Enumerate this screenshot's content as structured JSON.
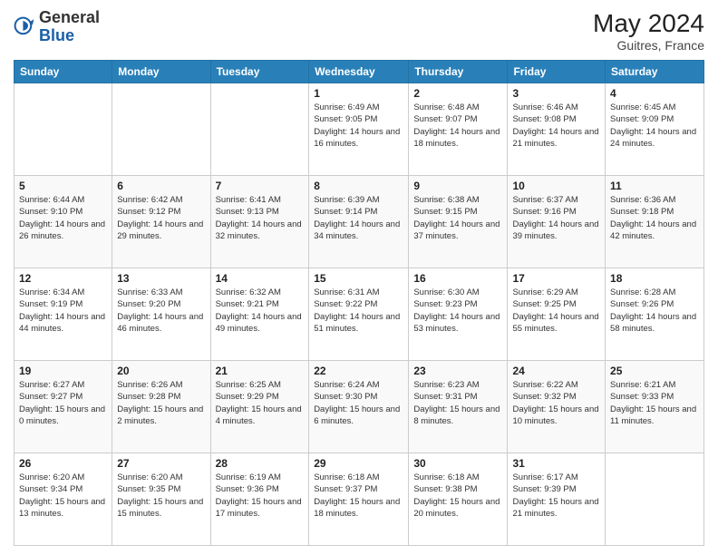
{
  "header": {
    "logo_general": "General",
    "logo_blue": "Blue",
    "month_year": "May 2024",
    "location": "Guitres, France"
  },
  "days_of_week": [
    "Sunday",
    "Monday",
    "Tuesday",
    "Wednesday",
    "Thursday",
    "Friday",
    "Saturday"
  ],
  "weeks": [
    [
      {
        "day": "",
        "sunrise": "",
        "sunset": "",
        "daylight": ""
      },
      {
        "day": "",
        "sunrise": "",
        "sunset": "",
        "daylight": ""
      },
      {
        "day": "",
        "sunrise": "",
        "sunset": "",
        "daylight": ""
      },
      {
        "day": "1",
        "sunrise": "Sunrise: 6:49 AM",
        "sunset": "Sunset: 9:05 PM",
        "daylight": "Daylight: 14 hours and 16 minutes."
      },
      {
        "day": "2",
        "sunrise": "Sunrise: 6:48 AM",
        "sunset": "Sunset: 9:07 PM",
        "daylight": "Daylight: 14 hours and 18 minutes."
      },
      {
        "day": "3",
        "sunrise": "Sunrise: 6:46 AM",
        "sunset": "Sunset: 9:08 PM",
        "daylight": "Daylight: 14 hours and 21 minutes."
      },
      {
        "day": "4",
        "sunrise": "Sunrise: 6:45 AM",
        "sunset": "Sunset: 9:09 PM",
        "daylight": "Daylight: 14 hours and 24 minutes."
      }
    ],
    [
      {
        "day": "5",
        "sunrise": "Sunrise: 6:44 AM",
        "sunset": "Sunset: 9:10 PM",
        "daylight": "Daylight: 14 hours and 26 minutes."
      },
      {
        "day": "6",
        "sunrise": "Sunrise: 6:42 AM",
        "sunset": "Sunset: 9:12 PM",
        "daylight": "Daylight: 14 hours and 29 minutes."
      },
      {
        "day": "7",
        "sunrise": "Sunrise: 6:41 AM",
        "sunset": "Sunset: 9:13 PM",
        "daylight": "Daylight: 14 hours and 32 minutes."
      },
      {
        "day": "8",
        "sunrise": "Sunrise: 6:39 AM",
        "sunset": "Sunset: 9:14 PM",
        "daylight": "Daylight: 14 hours and 34 minutes."
      },
      {
        "day": "9",
        "sunrise": "Sunrise: 6:38 AM",
        "sunset": "Sunset: 9:15 PM",
        "daylight": "Daylight: 14 hours and 37 minutes."
      },
      {
        "day": "10",
        "sunrise": "Sunrise: 6:37 AM",
        "sunset": "Sunset: 9:16 PM",
        "daylight": "Daylight: 14 hours and 39 minutes."
      },
      {
        "day": "11",
        "sunrise": "Sunrise: 6:36 AM",
        "sunset": "Sunset: 9:18 PM",
        "daylight": "Daylight: 14 hours and 42 minutes."
      }
    ],
    [
      {
        "day": "12",
        "sunrise": "Sunrise: 6:34 AM",
        "sunset": "Sunset: 9:19 PM",
        "daylight": "Daylight: 14 hours and 44 minutes."
      },
      {
        "day": "13",
        "sunrise": "Sunrise: 6:33 AM",
        "sunset": "Sunset: 9:20 PM",
        "daylight": "Daylight: 14 hours and 46 minutes."
      },
      {
        "day": "14",
        "sunrise": "Sunrise: 6:32 AM",
        "sunset": "Sunset: 9:21 PM",
        "daylight": "Daylight: 14 hours and 49 minutes."
      },
      {
        "day": "15",
        "sunrise": "Sunrise: 6:31 AM",
        "sunset": "Sunset: 9:22 PM",
        "daylight": "Daylight: 14 hours and 51 minutes."
      },
      {
        "day": "16",
        "sunrise": "Sunrise: 6:30 AM",
        "sunset": "Sunset: 9:23 PM",
        "daylight": "Daylight: 14 hours and 53 minutes."
      },
      {
        "day": "17",
        "sunrise": "Sunrise: 6:29 AM",
        "sunset": "Sunset: 9:25 PM",
        "daylight": "Daylight: 14 hours and 55 minutes."
      },
      {
        "day": "18",
        "sunrise": "Sunrise: 6:28 AM",
        "sunset": "Sunset: 9:26 PM",
        "daylight": "Daylight: 14 hours and 58 minutes."
      }
    ],
    [
      {
        "day": "19",
        "sunrise": "Sunrise: 6:27 AM",
        "sunset": "Sunset: 9:27 PM",
        "daylight": "Daylight: 15 hours and 0 minutes."
      },
      {
        "day": "20",
        "sunrise": "Sunrise: 6:26 AM",
        "sunset": "Sunset: 9:28 PM",
        "daylight": "Daylight: 15 hours and 2 minutes."
      },
      {
        "day": "21",
        "sunrise": "Sunrise: 6:25 AM",
        "sunset": "Sunset: 9:29 PM",
        "daylight": "Daylight: 15 hours and 4 minutes."
      },
      {
        "day": "22",
        "sunrise": "Sunrise: 6:24 AM",
        "sunset": "Sunset: 9:30 PM",
        "daylight": "Daylight: 15 hours and 6 minutes."
      },
      {
        "day": "23",
        "sunrise": "Sunrise: 6:23 AM",
        "sunset": "Sunset: 9:31 PM",
        "daylight": "Daylight: 15 hours and 8 minutes."
      },
      {
        "day": "24",
        "sunrise": "Sunrise: 6:22 AM",
        "sunset": "Sunset: 9:32 PM",
        "daylight": "Daylight: 15 hours and 10 minutes."
      },
      {
        "day": "25",
        "sunrise": "Sunrise: 6:21 AM",
        "sunset": "Sunset: 9:33 PM",
        "daylight": "Daylight: 15 hours and 11 minutes."
      }
    ],
    [
      {
        "day": "26",
        "sunrise": "Sunrise: 6:20 AM",
        "sunset": "Sunset: 9:34 PM",
        "daylight": "Daylight: 15 hours and 13 minutes."
      },
      {
        "day": "27",
        "sunrise": "Sunrise: 6:20 AM",
        "sunset": "Sunset: 9:35 PM",
        "daylight": "Daylight: 15 hours and 15 minutes."
      },
      {
        "day": "28",
        "sunrise": "Sunrise: 6:19 AM",
        "sunset": "Sunset: 9:36 PM",
        "daylight": "Daylight: 15 hours and 17 minutes."
      },
      {
        "day": "29",
        "sunrise": "Sunrise: 6:18 AM",
        "sunset": "Sunset: 9:37 PM",
        "daylight": "Daylight: 15 hours and 18 minutes."
      },
      {
        "day": "30",
        "sunrise": "Sunrise: 6:18 AM",
        "sunset": "Sunset: 9:38 PM",
        "daylight": "Daylight: 15 hours and 20 minutes."
      },
      {
        "day": "31",
        "sunrise": "Sunrise: 6:17 AM",
        "sunset": "Sunset: 9:39 PM",
        "daylight": "Daylight: 15 hours and 21 minutes."
      },
      {
        "day": "",
        "sunrise": "",
        "sunset": "",
        "daylight": ""
      }
    ]
  ]
}
